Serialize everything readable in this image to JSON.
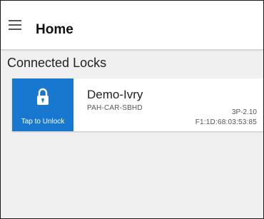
{
  "appbar": {
    "title": "Home",
    "menu_icon": "hamburger-menu-icon"
  },
  "section": {
    "title": "Connected Locks"
  },
  "locks": [
    {
      "name": "Demo-Ivry",
      "code": "PAH-CAR-SBHD",
      "version": "3P-2.10",
      "mac": "F1:1D:68:03:53:85",
      "unlock_label": "Tap to Unlock",
      "icon": "padlock-icon"
    }
  ],
  "colors": {
    "accent": "#1878cf",
    "background": "#f0f0f0",
    "card": "#ffffff"
  }
}
